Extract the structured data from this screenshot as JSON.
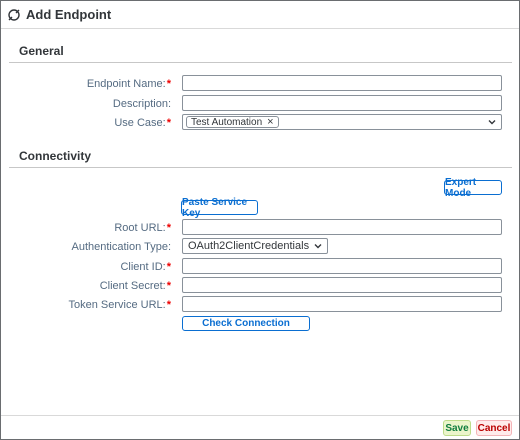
{
  "dialog": {
    "title": "Add Endpoint",
    "icon": "endpoint-plug-icon"
  },
  "general": {
    "section_title": "General",
    "endpoint_name": {
      "label": "Endpoint Name:",
      "required": "*",
      "value": ""
    },
    "description": {
      "label": "Description:",
      "value": ""
    },
    "use_case": {
      "label": "Use Case:",
      "required": "*",
      "tokens": [
        "Test Automation"
      ],
      "token_remove": "×"
    }
  },
  "connectivity": {
    "section_title": "Connectivity",
    "expert_mode_label": "Expert Mode",
    "paste_service_key_label": "Paste Service Key",
    "root_url": {
      "label": "Root URL:",
      "required": "*",
      "value": ""
    },
    "auth_type": {
      "label": "Authentication Type:",
      "value": "OAuth2ClientCredentials"
    },
    "client_id": {
      "label": "Client ID:",
      "required": "*",
      "value": ""
    },
    "client_secret": {
      "label": "Client Secret:",
      "required": "*",
      "value": ""
    },
    "token_service_url": {
      "label": "Token Service URL:",
      "required": "*",
      "value": ""
    },
    "check_connection_label": "Check Connection"
  },
  "footer": {
    "save_label": "Save",
    "cancel_label": "Cancel"
  },
  "colors": {
    "accent": "#0a6ed1",
    "required": "#ee0000",
    "save_bg": "#ebf5cb",
    "cancel_bg": "#ffebeb"
  }
}
